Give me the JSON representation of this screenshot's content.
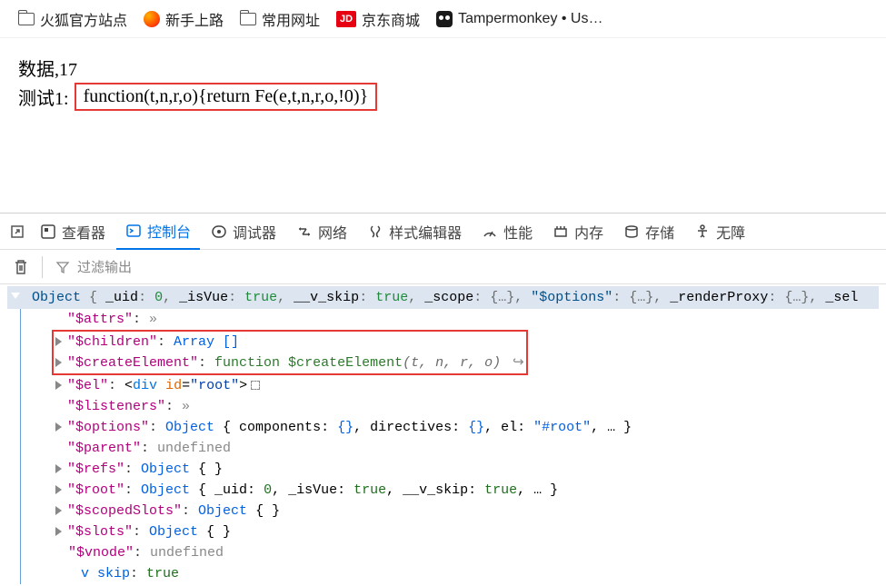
{
  "bookmarks": {
    "items": [
      {
        "label": "火狐官方站点",
        "icon": "folder"
      },
      {
        "label": "新手上路",
        "icon": "firefox"
      },
      {
        "label": "常用网址",
        "icon": "folder"
      },
      {
        "label": "京东商城",
        "icon": "jd",
        "badge": "JD"
      },
      {
        "label": "Tampermonkey • Us…",
        "icon": "tampermonkey"
      }
    ]
  },
  "page": {
    "line1": "数据,17",
    "line2_prefix": "测试1:",
    "line2_code": "function(t,n,r,o){return Fe(e,t,n,r,o,!0)}"
  },
  "devtools": {
    "tabs": [
      {
        "label": "查看器",
        "icon": "inspector"
      },
      {
        "label": "控制台",
        "icon": "console",
        "active": true
      },
      {
        "label": "调试器",
        "icon": "debugger"
      },
      {
        "label": "网络",
        "icon": "network"
      },
      {
        "label": "样式编辑器",
        "icon": "style"
      },
      {
        "label": "性能",
        "icon": "performance"
      },
      {
        "label": "内存",
        "icon": "memory"
      },
      {
        "label": "存储",
        "icon": "storage"
      },
      {
        "label": "无障",
        "icon": "accessibility"
      }
    ],
    "filter_placeholder": "过滤输出"
  },
  "console": {
    "object_summary": "Object { _uid: 0, _isVue: true, __v_skip: true, _scope: {…}, \"$options\": {…}, _renderProxy: {…}, _sel",
    "props": {
      "attrs": {
        "key": "\"$attrs\"",
        "value": "»"
      },
      "children": {
        "key": "\"$children\"",
        "value_type": "Array []"
      },
      "createElement": {
        "key": "\"$createElement\"",
        "fn": "function $createElement",
        "args": "(t, n, r, o)"
      },
      "el": {
        "key": "\"$el\"",
        "tag": "div",
        "attr_name": "id",
        "attr_value": "\"root\""
      },
      "listeners": {
        "key": "\"$listeners\"",
        "value": "»"
      },
      "options": {
        "key": "\"$options\"",
        "preview": "Object { components: {}, directives: {}, el: \"#root\", … }"
      },
      "parent": {
        "key": "\"$parent\"",
        "value": "undefined"
      },
      "refs": {
        "key": "\"$refs\"",
        "preview": "Object {  }"
      },
      "root": {
        "key": "\"$root\"",
        "preview": "Object { _uid: 0, _isVue: true, __v_skip: true, … }"
      },
      "scopedSlots": {
        "key": "\"$scopedSlots\"",
        "preview": "Object {  }"
      },
      "slots": {
        "key": "\"$slots\"",
        "preview": "Object {  }"
      },
      "vnode": {
        "key": "\"$vnode\"",
        "value": "undefined"
      },
      "vskip": {
        "key": "v skip",
        "value": "true"
      }
    }
  }
}
